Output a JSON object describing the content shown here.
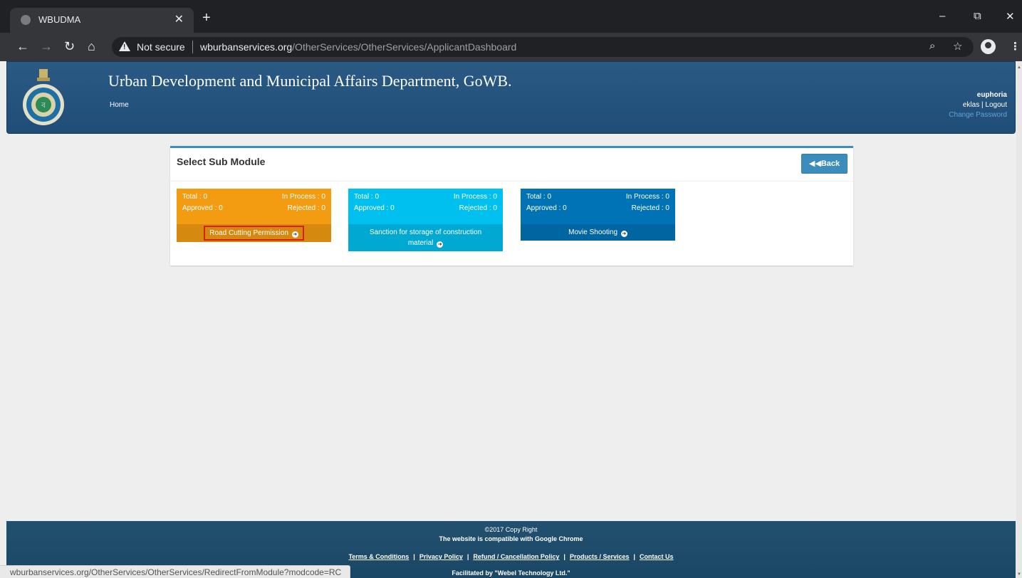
{
  "browser": {
    "tab_title": "WBUDMA",
    "tab_close": "✕",
    "new_tab": "+",
    "not_secure": "Not secure",
    "url_domain": "wburbanservices.org",
    "url_path": "/OtherServices/OtherServices/ApplicantDashboard",
    "status_url": "wburbanservices.org/OtherServices/OtherServices/RedirectFromModule?modcode=RC",
    "icons": [
      "globe-icon",
      "back-arrow-icon",
      "forward-arrow-icon",
      "reload-icon",
      "home-icon",
      "warning-icon",
      "zoom-icon",
      "star-icon",
      "profile-icon",
      "menu-icon",
      "minimize-icon",
      "restore-icon",
      "close-icon"
    ]
  },
  "header": {
    "title": "Urban Development and Municipal Affairs Department, GoWB.",
    "home": "Home",
    "username": "euphoria",
    "user_link": "eklas",
    "separator": "|",
    "logout": "Logout",
    "change_password": "Change Password",
    "header_color": "#23527c"
  },
  "panel": {
    "title": "Select Sub Module",
    "back_label": "Back",
    "modules": [
      {
        "total": "Total : 0",
        "in_process": "In Process : 0",
        "approved": "Approved : 0",
        "rejected": "Rejected : 0",
        "name": "Road Cutting Permission",
        "color": "#f39c12"
      },
      {
        "total": "Total : 0",
        "in_process": "In Process : 0",
        "approved": "Approved : 0",
        "rejected": "Rejected : 0",
        "name": "Sanction for storage of construction material",
        "color": "#00c0ef"
      },
      {
        "total": "Total : 0",
        "in_process": "In Process : 0",
        "approved": "Approved : 0",
        "rejected": "Rejected : 0",
        "name": "Movie Shooting",
        "color": "#0073b7"
      }
    ]
  },
  "footer": {
    "copyright": "©2017 Copy Right",
    "compat": "The website is compatible with Google Chrome",
    "links": [
      "Terms & Conditions",
      "Privacy Policy",
      "Refund / Cancellation Policy",
      "Products / Services",
      "Contact Us"
    ],
    "facilitated": "Facilitated by \"Webel Technology Ltd.\""
  }
}
